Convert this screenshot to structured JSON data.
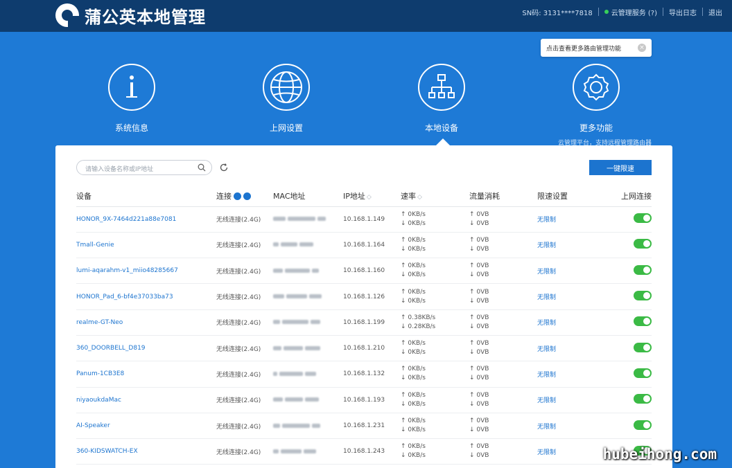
{
  "header": {
    "app_title": "蒲公英本地管理",
    "sn_text": "SN码: 3131****7818",
    "cloud_label": "云管理服务 (?)",
    "export_log": "导出日志",
    "logout": "退出"
  },
  "tooltip": {
    "text": "点击查看更多路由管理功能"
  },
  "nav": [
    {
      "label": "系统信息",
      "icon": "info-icon"
    },
    {
      "label": "上网设置",
      "icon": "globe-icon"
    },
    {
      "label": "本地设备",
      "icon": "network-tree-icon"
    },
    {
      "label": "更多功能",
      "icon": "gear-icon",
      "sub": "云管理平台，支持远程管理路由器"
    }
  ],
  "panel": {
    "search_placeholder": "请输入设备名称或IP地址",
    "batch_button": "一键限速"
  },
  "table": {
    "headers": [
      "设备",
      "连接",
      "MAC地址",
      "IP地址",
      "速率",
      "流量消耗",
      "限速设置",
      "上网连接"
    ],
    "rows": [
      {
        "device": "HONOR_9X-7464d221a88e7081",
        "conn": "无线连接(2.4G)",
        "ip": "10.168.1.149",
        "up": "0KB/s",
        "down": "0KB/s",
        "t_up": "0VB",
        "t_down": "0VB",
        "limit": "无限制",
        "online": true
      },
      {
        "device": "Tmall-Genie",
        "conn": "无线连接(2.4G)",
        "ip": "10.168.1.164",
        "up": "0KB/s",
        "down": "0KB/s",
        "t_up": "0VB",
        "t_down": "0VB",
        "limit": "无限制",
        "online": true
      },
      {
        "device": "lumi-aqarahm-v1_miio48285667",
        "conn": "无线连接(2.4G)",
        "ip": "10.168.1.160",
        "up": "0KB/s",
        "down": "0KB/s",
        "t_up": "0VB",
        "t_down": "0VB",
        "limit": "无限制",
        "online": true
      },
      {
        "device": "HONOR_Pad_6-bf4e37033ba73",
        "conn": "无线连接(2.4G)",
        "ip": "10.168.1.126",
        "up": "0KB/s",
        "down": "0KB/s",
        "t_up": "0VB",
        "t_down": "0VB",
        "limit": "无限制",
        "online": true
      },
      {
        "device": "realme-GT-Neo",
        "conn": "无线连接(2.4G)",
        "ip": "10.168.1.199",
        "up": "0.38KB/s",
        "down": "0.28KB/s",
        "t_up": "0VB",
        "t_down": "0VB",
        "limit": "无限制",
        "online": true
      },
      {
        "device": "360_DOORBELL_D819",
        "conn": "无线连接(2.4G)",
        "ip": "10.168.1.210",
        "up": "0KB/s",
        "down": "0KB/s",
        "t_up": "0VB",
        "t_down": "0VB",
        "limit": "无限制",
        "online": true
      },
      {
        "device": "Panum-1CB3E8",
        "conn": "无线连接(2.4G)",
        "ip": "10.168.1.132",
        "up": "0KB/s",
        "down": "0KB/s",
        "t_up": "0VB",
        "t_down": "0VB",
        "limit": "无限制",
        "online": true
      },
      {
        "device": "niyaoukdaMac",
        "conn": "无线连接(2.4G)",
        "ip": "10.168.1.193",
        "up": "0KB/s",
        "down": "0KB/s",
        "t_up": "0VB",
        "t_down": "0VB",
        "limit": "无限制",
        "online": true
      },
      {
        "device": "AI-Speaker",
        "conn": "无线连接(2.4G)",
        "ip": "10.168.1.231",
        "up": "0KB/s",
        "down": "0KB/s",
        "t_up": "0VB",
        "t_down": "0VB",
        "limit": "无限制",
        "online": true
      },
      {
        "device": "360-KIDSWATCH-EX",
        "conn": "无线连接(2.4G)",
        "ip": "10.168.1.243",
        "up": "0KB/s",
        "down": "0KB/s",
        "t_up": "0VB",
        "t_down": "0VB",
        "limit": "无限制",
        "online": true
      }
    ]
  },
  "watermark": "hubeihong.com",
  "colors": {
    "header": "#0e3c6e",
    "background": "#1e7ad6",
    "accent": "#1c74cf",
    "toggle_on": "#3bba45"
  }
}
